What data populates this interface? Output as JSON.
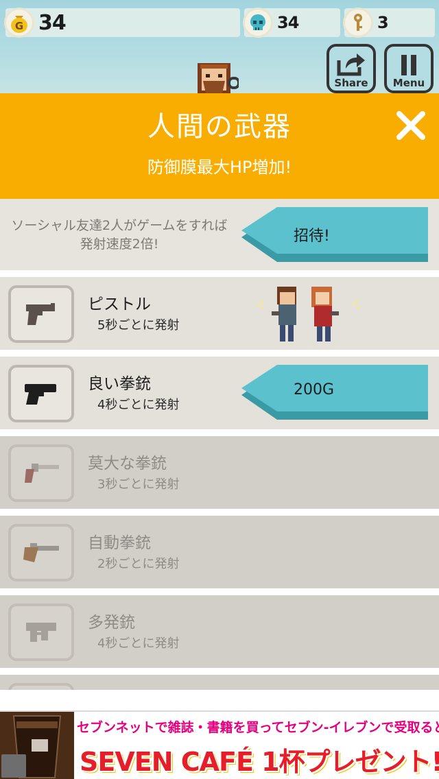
{
  "hud": {
    "gold": "34",
    "zombies": "34",
    "keys": "3",
    "share_label": "Share",
    "menu_label": "Menu",
    "gold_icon_letter": "G"
  },
  "panel": {
    "title": "人間の武器",
    "subtitle": "防御膜最大HP増加!"
  },
  "invite": {
    "text": "ソーシャル友達2人がゲームをすれば発射速度2倍!",
    "button": "招待!"
  },
  "weapons": [
    {
      "name": "ピストル",
      "rate": "5秒ごとに発射",
      "state": "owned",
      "icon": "pistol-icon"
    },
    {
      "name": "良い拳銃",
      "rate": "4秒ごとに発射",
      "state": "buy",
      "price": "200G",
      "icon": "handgun-icon"
    },
    {
      "name": "莫大な拳銃",
      "rate": "3秒ごとに発射",
      "state": "locked",
      "icon": "revolver-icon"
    },
    {
      "name": "自動拳銃",
      "rate": "2秒ごとに発射",
      "state": "locked",
      "icon": "flintlock-icon"
    },
    {
      "name": "多発銃",
      "rate": "4秒ごとに発射",
      "state": "locked",
      "icon": "smg-icon"
    }
  ],
  "ad": {
    "line1": "セブンネットで雑誌・書籍を買ってセブン-イレブンで受取ると",
    "line2": "SEVEN CAFÉ 1杯プレゼント!"
  },
  "colors": {
    "accent": "#f8ad00",
    "button": "#5ac1cd",
    "button_shadow": "#3a9aa6"
  }
}
